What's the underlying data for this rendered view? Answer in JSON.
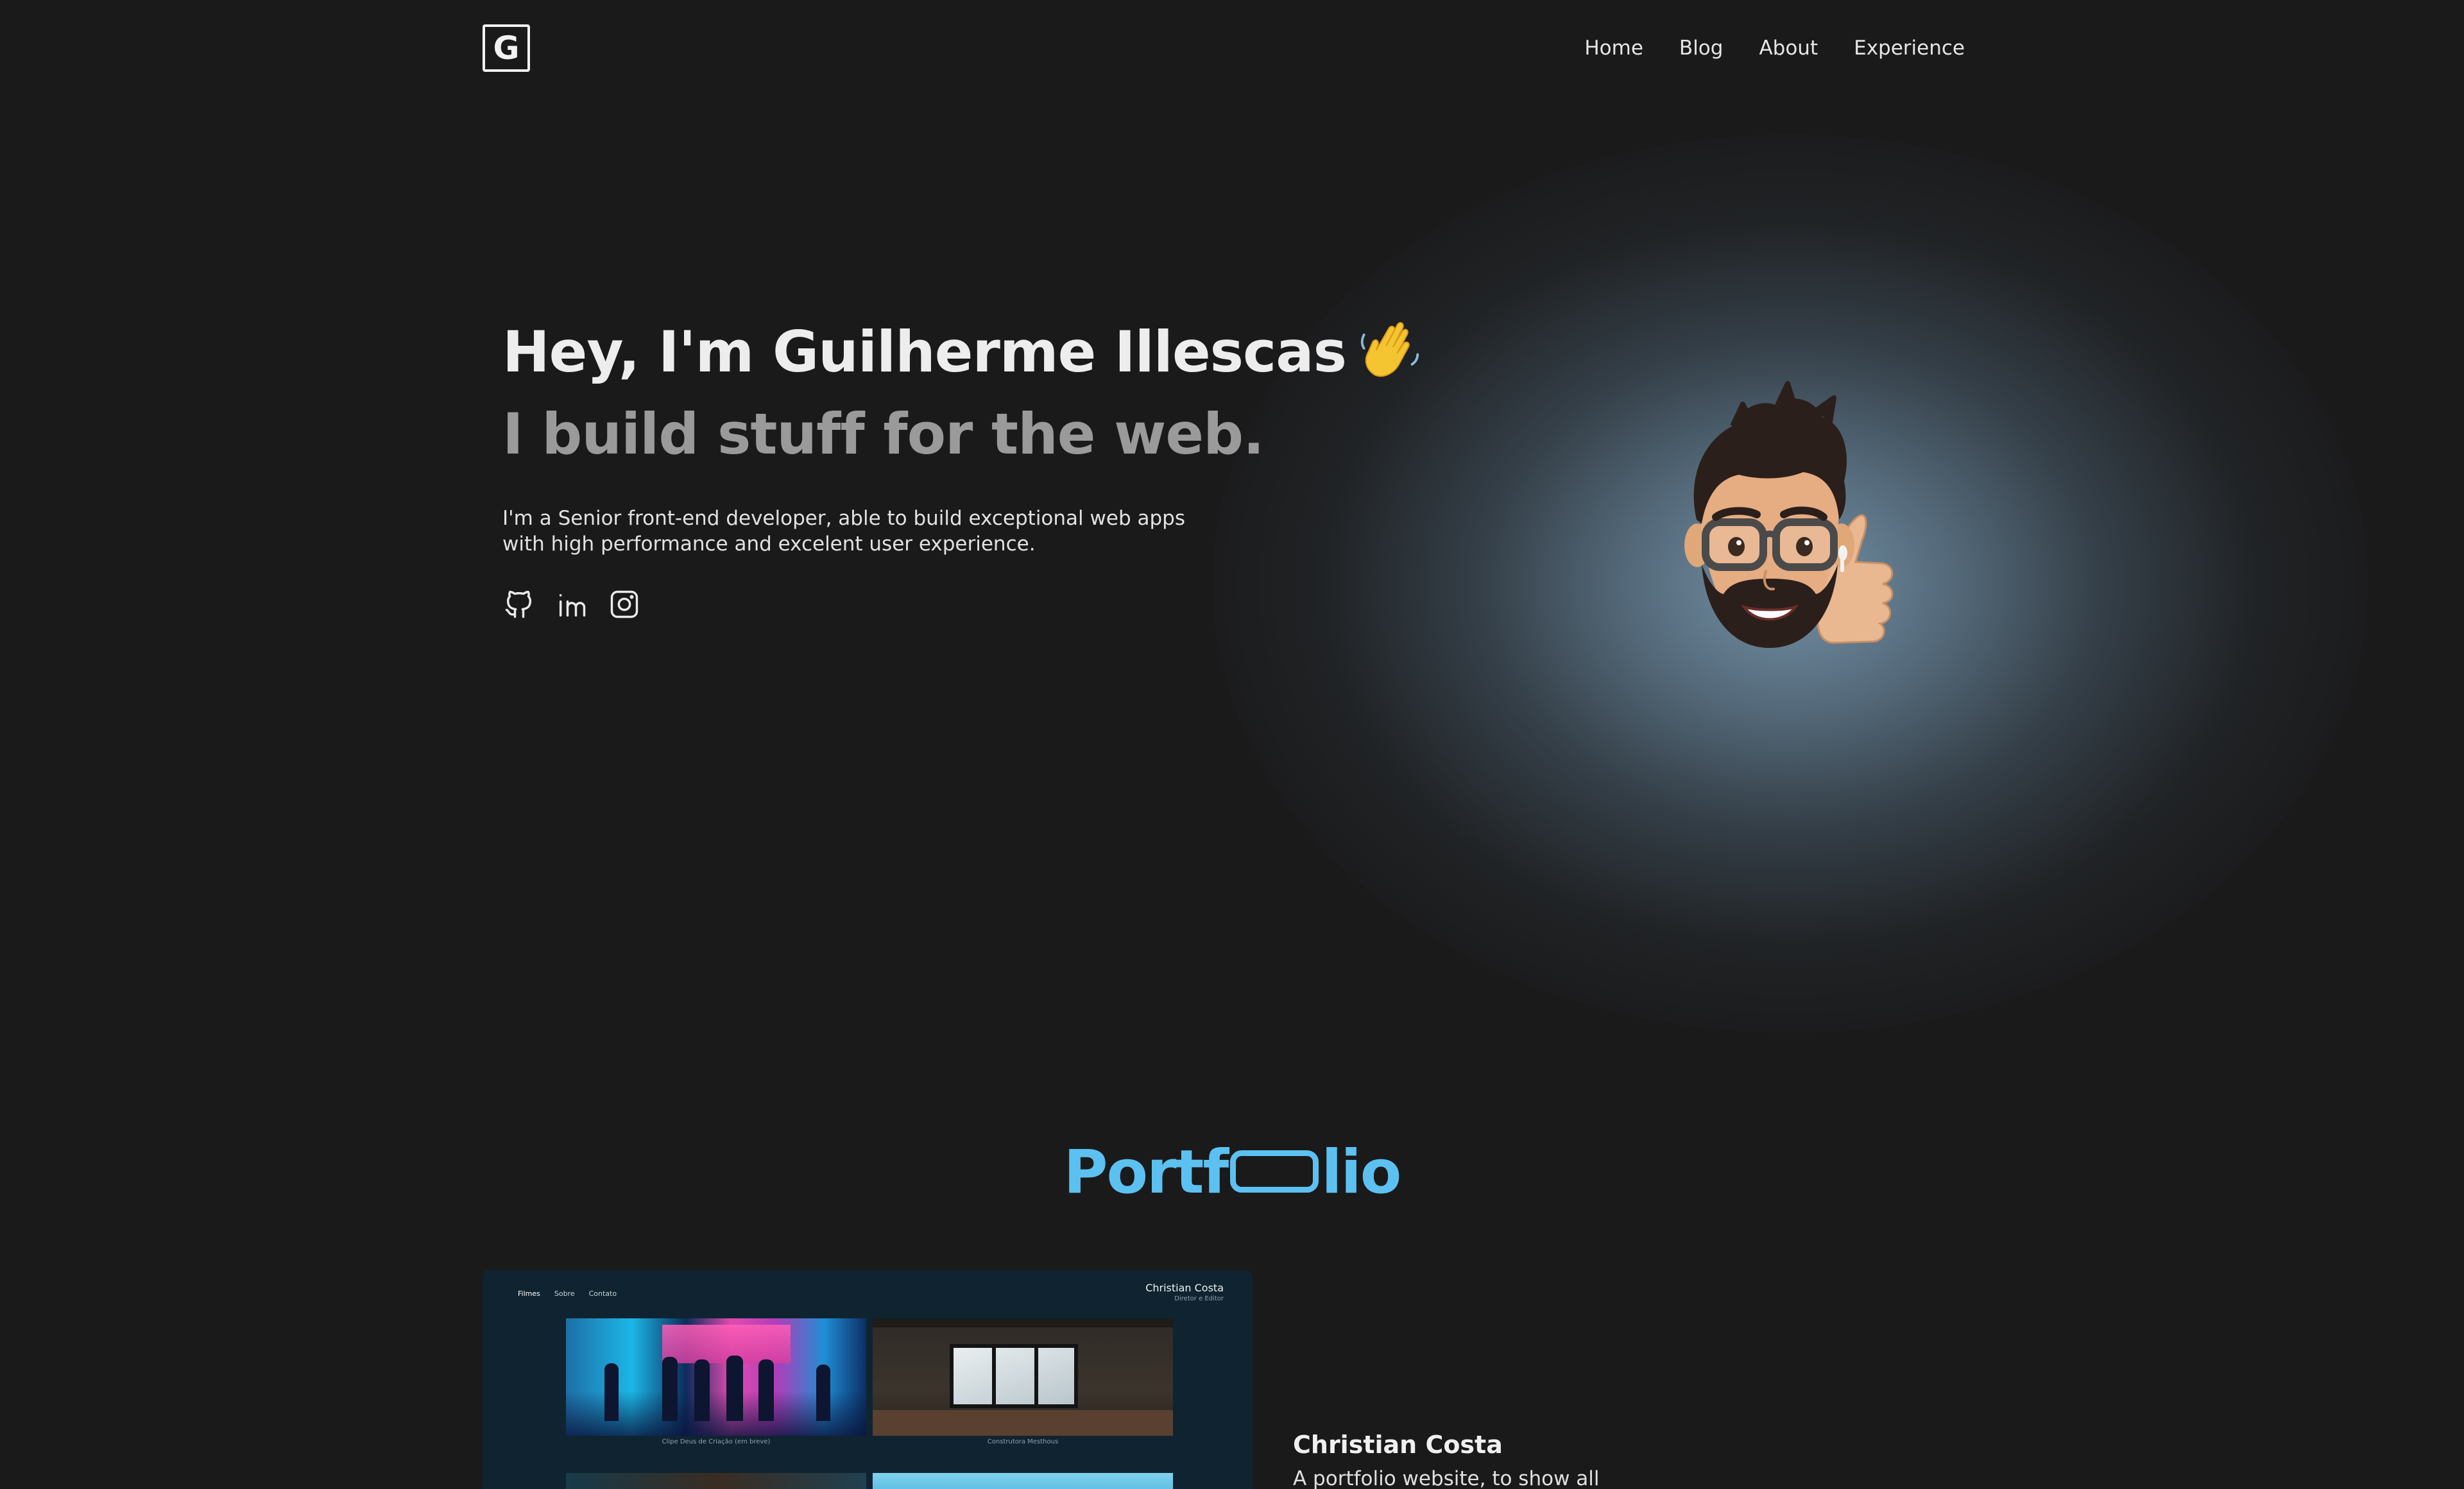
{
  "header": {
    "logo_letter": "G",
    "nav": [
      "Home",
      "Blog",
      "About",
      "Experience"
    ]
  },
  "hero": {
    "greeting": "Hey, I'm Guilherme Illescas",
    "wave_emoji": "👋",
    "tagline": "I build stuff for the web.",
    "description": "I'm a Senior front-end developer, able to build exceptional web apps with high performance and excelent user experience.",
    "social_icons": [
      "github-icon",
      "linkedin-icon",
      "instagram-icon"
    ],
    "avatar_icon": "memoji-thumbs-up"
  },
  "portfolio": {
    "title_start": "Portf",
    "title_end": "lio",
    "project": {
      "name": "Christian Costa",
      "description": "A portfolio website, to show all",
      "screenshot": {
        "nav": [
          "Filmes",
          "Sobre",
          "Contato"
        ],
        "brand": "Christian Costa",
        "brand_sub": "Diretor e Editor",
        "captions": [
          "Clipe Deus de Criação (em breve)",
          "Construtora Mesthous"
        ]
      }
    }
  },
  "colors": {
    "background": "#1a1a1b",
    "accent": "#5cc1f0",
    "muted": "#9a9a9a"
  }
}
